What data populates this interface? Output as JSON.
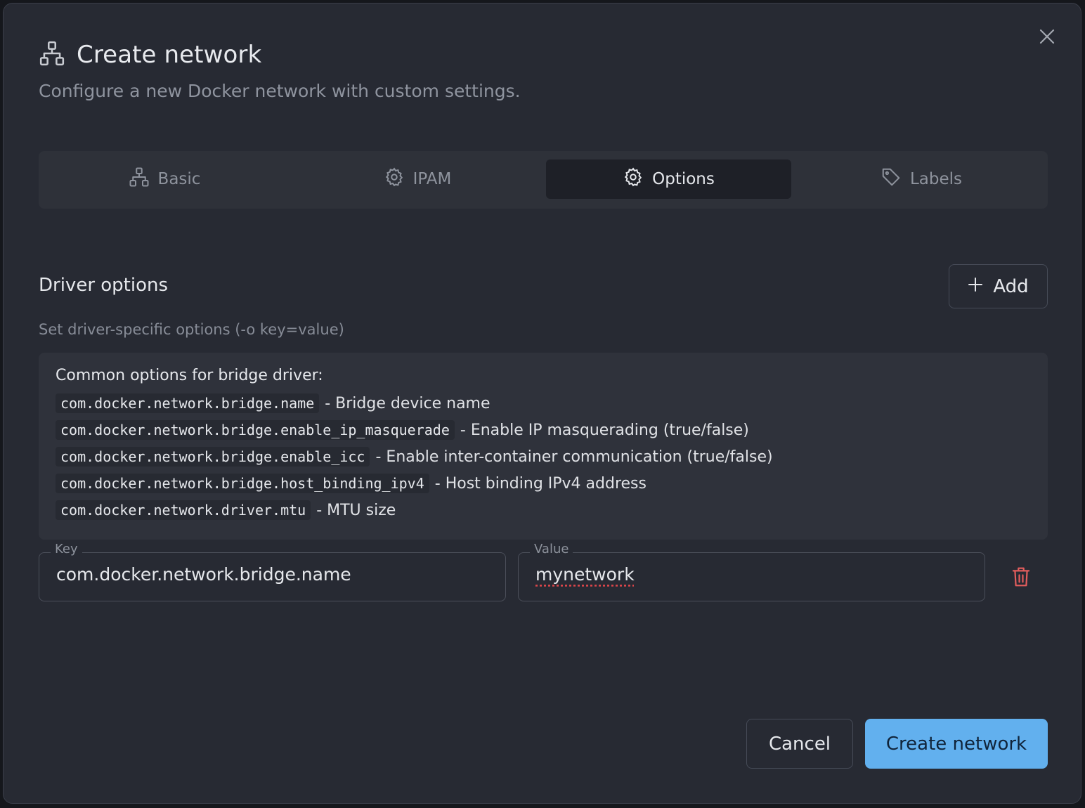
{
  "dialog": {
    "title": "Create network",
    "subtitle": "Configure a new Docker network with custom settings.",
    "close_icon": "close-icon"
  },
  "tabs": [
    {
      "label": "Basic",
      "icon": "network-icon",
      "active": false
    },
    {
      "label": "IPAM",
      "icon": "gear-icon",
      "active": false
    },
    {
      "label": "Options",
      "icon": "gear-icon",
      "active": true
    },
    {
      "label": "Labels",
      "icon": "tag-icon",
      "active": false
    }
  ],
  "driver_options": {
    "title": "Driver options",
    "subtitle": "Set driver-specific options (-o key=value)",
    "add_label": "Add",
    "help": {
      "title": "Common options for bridge driver:",
      "items": [
        {
          "code": "com.docker.network.bridge.name",
          "desc": "- Bridge device name"
        },
        {
          "code": "com.docker.network.bridge.enable_ip_masquerade",
          "desc": "- Enable IP masquerading (true/false)"
        },
        {
          "code": "com.docker.network.bridge.enable_icc",
          "desc": "- Enable inter-container communication (true/false)"
        },
        {
          "code": "com.docker.network.bridge.host_binding_ipv4",
          "desc": "- Host binding IPv4 address"
        },
        {
          "code": "com.docker.network.driver.mtu",
          "desc": "- MTU size"
        }
      ]
    },
    "row": {
      "key_label": "Key",
      "key_value": "com.docker.network.bridge.name",
      "value_label": "Value",
      "value_value": "mynetwork"
    }
  },
  "footer": {
    "cancel_label": "Cancel",
    "create_label": "Create network"
  },
  "colors": {
    "primary": "#62b0ee",
    "danger": "#e35d5d",
    "dialog_bg": "#272a33"
  }
}
